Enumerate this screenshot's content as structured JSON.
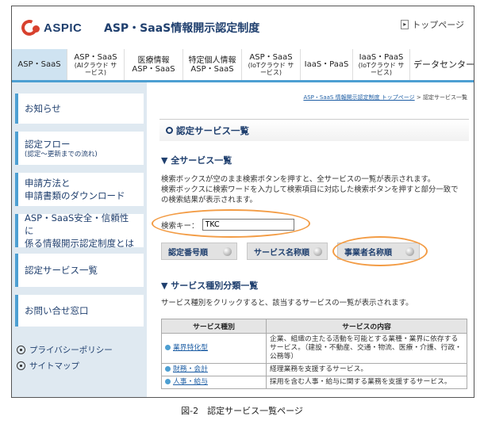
{
  "header": {
    "logo_text": "ASPIC",
    "site_title": "ASP・SaaS情報開示認定制度",
    "top_link": "トップページ"
  },
  "tabs": [
    {
      "label": "ASP・SaaS",
      "sub": ""
    },
    {
      "label": "ASP・SaaS",
      "sub": "(AIクラウド サービス)"
    },
    {
      "label": "医療情報",
      "sub": "ASP・SaaS"
    },
    {
      "label": "特定個人情報",
      "sub": "ASP・SaaS"
    },
    {
      "label": "ASP・SaaS",
      "sub": "(IoTクラウド サービス)"
    },
    {
      "label": "IaaS・PaaS",
      "sub": ""
    },
    {
      "label": "IaaS・PaaS",
      "sub": "(IoTクラウド サービス)"
    },
    {
      "label": "データセンター",
      "sub": ""
    }
  ],
  "sidebar": {
    "items": [
      {
        "label": "お知らせ",
        "sub": ""
      },
      {
        "label": "認定フロー",
        "sub": "(認定～更新までの流れ)"
      },
      {
        "label": "申請方法と",
        "label2": "申請書類のダウンロード"
      },
      {
        "label": "ASP・SaaS安全・信頼性に",
        "label2": "係る情報開示認定制度とは"
      },
      {
        "label": "認定サービス一覧",
        "sub": ""
      },
      {
        "label": "お問い合せ窓口",
        "sub": ""
      }
    ],
    "privacy": "プライバシーポリシー",
    "sitemap": "サイトマップ"
  },
  "main": {
    "breadcrumb_link": "ASP・SaaS 情報開示認定制度 トップページ",
    "breadcrumb_sep": " > ",
    "breadcrumb_current": "認定サービス一覧",
    "heading": "認定サービス一覧",
    "all_title": "▼ 全サービス一覧",
    "all_desc_1": "検索ボックスが空のまま検索ボタンを押すと、全サービスの一覧が表示されます。",
    "all_desc_2": "検索ボックスに検索ワードを入力して検索項目に対応した検索ボタンを押すと部分一致で",
    "all_desc_3": "の検索結果が表示されます。",
    "search_label": "検索キー：",
    "search_value": "TKC",
    "btn_number": "認定番号順",
    "btn_service": "サービス名称順",
    "btn_company": "事業者名称順",
    "category_title": "▼ サービス種別分類一覧",
    "category_desc": "サービス種別をクリックすると、該当するサービスの一覧が表示されます。",
    "table": {
      "headers": [
        "サービス種別",
        "サービスの内容"
      ],
      "rows": [
        {
          "name": "業界特化型",
          "desc": "企業、組織の主たる活動を可能とする業種・業界に依存するサービス。（建設・不動産、交通・物流、医療・介護、行政・公務等）"
        },
        {
          "name": "財務・会計",
          "desc": "経理業務を支援するサービス。"
        },
        {
          "name": "人事・給与",
          "desc": "採用を含む人事・給与に関する業務を支援するサービス。"
        }
      ]
    }
  },
  "caption": "図-2　認定サービス一覧ページ",
  "colors": {
    "brand_red": "#d8412e",
    "navy": "#1f3f6e",
    "blue": "#4d9fd2",
    "highlight": "#f39c45",
    "sidebar_bg": "#dfe9f1"
  }
}
